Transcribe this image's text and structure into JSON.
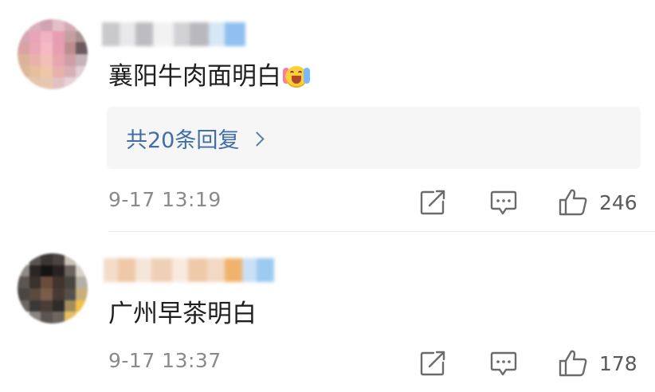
{
  "comments": [
    {
      "text": "襄阳牛肉面明白",
      "emoji": "cheering-face-emoji",
      "replies_label": "共20条回复",
      "timestamp": "9-17 13:19",
      "likes": "246"
    },
    {
      "text": "广州早茶明白",
      "timestamp": "9-17 13:37",
      "likes": "178"
    }
  ],
  "icons": {
    "share": "share-icon",
    "comment": "comment-icon",
    "like": "thumbs-up-icon",
    "chevron": "chevron-right-icon"
  },
  "colors": {
    "reply_link": "#3f6ea8",
    "meta_text": "#8a8a8a",
    "icon": "#6b6b6b",
    "reply_box_bg": "#f6f6f7"
  }
}
